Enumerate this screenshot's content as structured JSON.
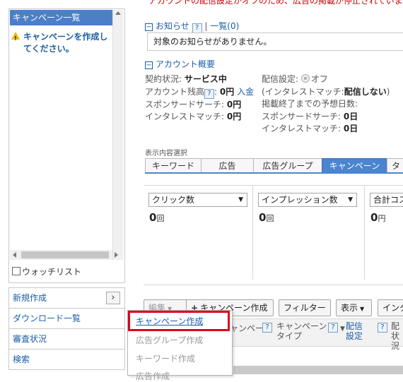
{
  "top_warning": "アカウントの配信設定がオフのため、広告の掲載が停止されています。",
  "sidebar": {
    "campaign_list_title": "キャンペーン一覧",
    "warning_message": "キャンペーンを作成してください。",
    "watchlist_label": "ウォッチリスト",
    "menu_items": [
      {
        "label": "新規作成",
        "icon": "chevron-right-icon"
      },
      {
        "label": "ダウンロード一覧"
      },
      {
        "label": "審査状況"
      },
      {
        "label": "検索"
      }
    ]
  },
  "notices": {
    "title": "お知らせ",
    "help": "?",
    "link": "一覧(0)",
    "message": "対象のお知らせがありません。"
  },
  "account": {
    "title": "アカウント概要",
    "contract_label": "契約状況:",
    "contract_value": "サービス中",
    "balance_label": "アカウント残高",
    "balance_value": "0円",
    "deposit_link": "入金",
    "sponsored_label": "スポンサードサーチ:",
    "sponsored_value": "0円",
    "interest_label": "インタレストマッチ:",
    "interest_value": "0円",
    "delivery_label": "配信設定:",
    "delivery_value": "オフ",
    "interest_delivery_label": "(インタレストマッチ:",
    "interest_delivery_value": "配信しない",
    "interest_delivery_close": ")",
    "forecast_label": "掲載終了までの予想日数:",
    "forecast_sponsored_label": "スポンサードサーチ:",
    "forecast_sponsored_value": "0日",
    "forecast_interest_label": "インタレストマッチ:",
    "forecast_interest_value": "0日"
  },
  "view": {
    "label": "表示内容選択",
    "tabs": [
      "キーワード",
      "広告",
      "広告グループ",
      "キャンペーン",
      "タ"
    ],
    "active_tab": "キャンペーン"
  },
  "metrics": [
    {
      "select": "クリック数",
      "value": "0",
      "unit": "回"
    },
    {
      "select": "インプレッション数",
      "value": "0",
      "unit": "回"
    },
    {
      "select": "合計コス",
      "value": "0",
      "unit": "円"
    }
  ],
  "toolbar": {
    "edit": "編集",
    "create_campaign": "キャンペーン作成",
    "filter": "フィルター",
    "display": "表示",
    "more": "インタ"
  },
  "table_header": {
    "col1": "ャンペー",
    "col2_line1": "キャンペーン",
    "col2_line2": "タイプ",
    "col3_line1": "配信",
    "col3_line2": "設定",
    "col4_line1": "配",
    "col4_line2": "状況",
    "help": "?"
  },
  "dropdown": {
    "options": [
      "キャンペーン作成",
      "広告グループ作成",
      "キーワード作成",
      "広告作成"
    ],
    "active": "キャンペーン作成"
  },
  "colors": {
    "accent": "#4b84d0",
    "link": "#1a5ea8",
    "warning": "#cc0000",
    "highlight": "#e0001b"
  }
}
